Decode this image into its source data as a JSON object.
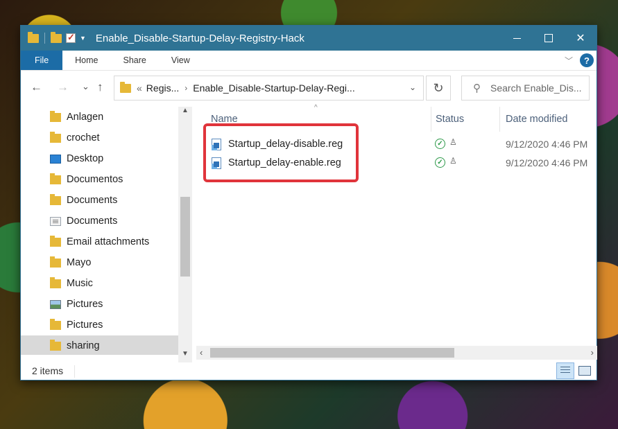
{
  "window": {
    "title": "Enable_Disable-Startup-Delay-Registry-Hack",
    "controls": {
      "minimize": "",
      "maximize": "",
      "close": "✕"
    }
  },
  "ribbon": {
    "tabs": [
      "File",
      "Home",
      "Share",
      "View"
    ],
    "help": "?"
  },
  "navbar": {
    "back": "←",
    "forward": "→",
    "recent": "⌄",
    "up": "↑",
    "address": {
      "overflow": "«",
      "crumbs": [
        "Regis...",
        "Enable_Disable-Startup-Delay-Regi..."
      ],
      "separator": "›",
      "dropdown": "⌄"
    },
    "refresh": "↻",
    "search_placeholder": "Search Enable_Dis..."
  },
  "sidebar": {
    "items": [
      {
        "label": "Anlagen",
        "icon": "folder-icon"
      },
      {
        "label": "crochet",
        "icon": "folder-icon"
      },
      {
        "label": "Desktop",
        "icon": "desktop-icon"
      },
      {
        "label": "Documentos",
        "icon": "folder-icon"
      },
      {
        "label": "Documents",
        "icon": "folder-icon"
      },
      {
        "label": "Documents",
        "icon": "documents-icon"
      },
      {
        "label": "Email attachments",
        "icon": "folder-icon"
      },
      {
        "label": "Mayo",
        "icon": "folder-icon"
      },
      {
        "label": "Music",
        "icon": "folder-icon"
      },
      {
        "label": "Pictures",
        "icon": "pictures-icon"
      },
      {
        "label": "Pictures",
        "icon": "folder-icon"
      },
      {
        "label": "sharing",
        "icon": "folder-icon",
        "selected": true
      }
    ]
  },
  "columns": {
    "name": "Name",
    "status": "Status",
    "date_modified": "Date modified",
    "sort_indicator": "^"
  },
  "files": [
    {
      "name": "Startup_delay-disable.reg",
      "status": "available",
      "date": "9/12/2020 4:46 PM"
    },
    {
      "name": "Startup_delay-enable.reg",
      "status": "available",
      "date": "9/12/2020 4:46 PM"
    }
  ],
  "statusbar": {
    "item_count": "2 items"
  },
  "colors": {
    "titlebar": "#2f7394",
    "file_tab": "#1c6ca6",
    "highlight": "#e0343b"
  }
}
